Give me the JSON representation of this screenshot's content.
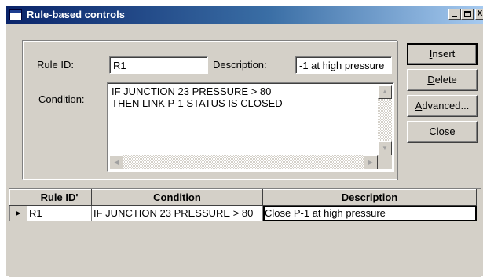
{
  "window": {
    "title": "Rule-based controls",
    "controls": {
      "minimize": "_",
      "maximize": "□",
      "close": "X"
    }
  },
  "form": {
    "rule_id_label": "Rule ID:",
    "rule_id_value": "R1",
    "description_label": "Description:",
    "description_value": "-1 at high pressure",
    "condition_label": "Condition:",
    "condition_text": "IF JUNCTION 23 PRESSURE > 80\nTHEN LINK P-1 STATUS IS CLOSED"
  },
  "buttons": {
    "insert": {
      "mnemonic": "I",
      "rest": "nsert"
    },
    "delete": {
      "mnemonic": "D",
      "rest": "elete"
    },
    "advanced": {
      "mnemonic": "A",
      "rest": "dvanced..."
    },
    "close": "Close"
  },
  "grid": {
    "columns": [
      "Rule ID'",
      "Condition",
      "Description"
    ],
    "rows": [
      {
        "indicator": "▶",
        "rule_id": "R1",
        "condition": "IF JUNCTION 23 PRESSURE > 80",
        "description": "Close P-1 at high pressure"
      }
    ]
  },
  "colors": {
    "titlebar_start": "#0a246a",
    "titlebar_end": "#a6caf0",
    "face": "#d4d0c8"
  }
}
